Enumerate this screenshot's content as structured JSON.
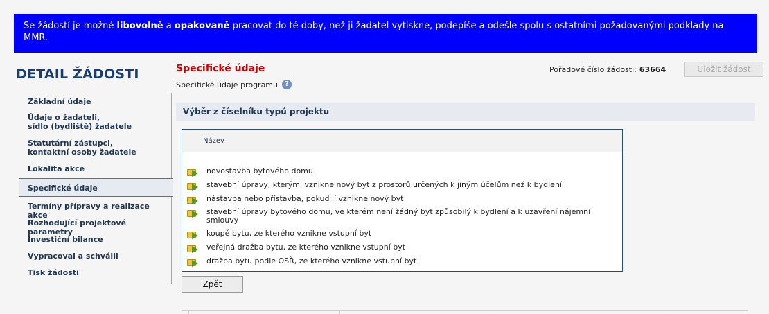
{
  "banner": {
    "part1": "Se žádostí je možné ",
    "bold1": "libovolně",
    "part2": " a ",
    "bold2": "opakovaně",
    "part3": " pracovat do té doby, než ji žadatel vytiskne, podepíše a odešle spolu s ostatními požadovanými podklady na MMR."
  },
  "sidebar": {
    "title": "DETAIL ŽÁDOSTI",
    "items": [
      {
        "line1": "Základní údaje",
        "line2": ""
      },
      {
        "line1": "Údaje o žadateli,",
        "line2": "sídlo (bydliště) žadatele"
      },
      {
        "line1": "Statutární zástupci,",
        "line2": "kontaktní osoby žadatele"
      },
      {
        "line1": "Lokalita akce",
        "line2": ""
      },
      {
        "line1": "Specifické údaje",
        "line2": ""
      },
      {
        "line1": "Termíny přípravy a realizace akce",
        "line2": ""
      },
      {
        "line1": "Rozhodující projektové parametry",
        "line2": ""
      },
      {
        "line1": "Investiční bilance",
        "line2": ""
      },
      {
        "line1": "Vypracoval a schválil",
        "line2": ""
      },
      {
        "line1": "Tisk žádosti",
        "line2": ""
      }
    ],
    "active_index": 4
  },
  "main": {
    "title": "Specifické údaje",
    "subtitle": "Specifické údaje programu",
    "help_icon": "?",
    "order_label": "Pořadové číslo žádosti:",
    "order_number": "63664",
    "save_label": "Uložit žádost",
    "section_title": "Výběr z číselníku typů projektu",
    "table_header": "Název",
    "rows": [
      "novostavba bytového domu",
      "stavební úpravy, kterými vznikne nový byt z prostorů určených k jiným účelům než k bydlení",
      "nástavba nebo přístavba, pokud jí vznikne nový byt",
      "stavební úpravy bytového domu, ve kterém není žádný byt způsobilý k bydlení a k uzavření nájemní smlouvy",
      "koupě bytu, ze kterého vznikne vstupní byt",
      "veřejná dražba bytu, ze kterého vznikne vstupní byt",
      "dražba bytu podle OSŘ, ze kterého vznikne vstupní byt"
    ],
    "back_label": "Zpět"
  },
  "colors": {
    "banner_bg": "#0000ff",
    "title_red": "#cc0000",
    "nav_text": "#1f3551"
  }
}
